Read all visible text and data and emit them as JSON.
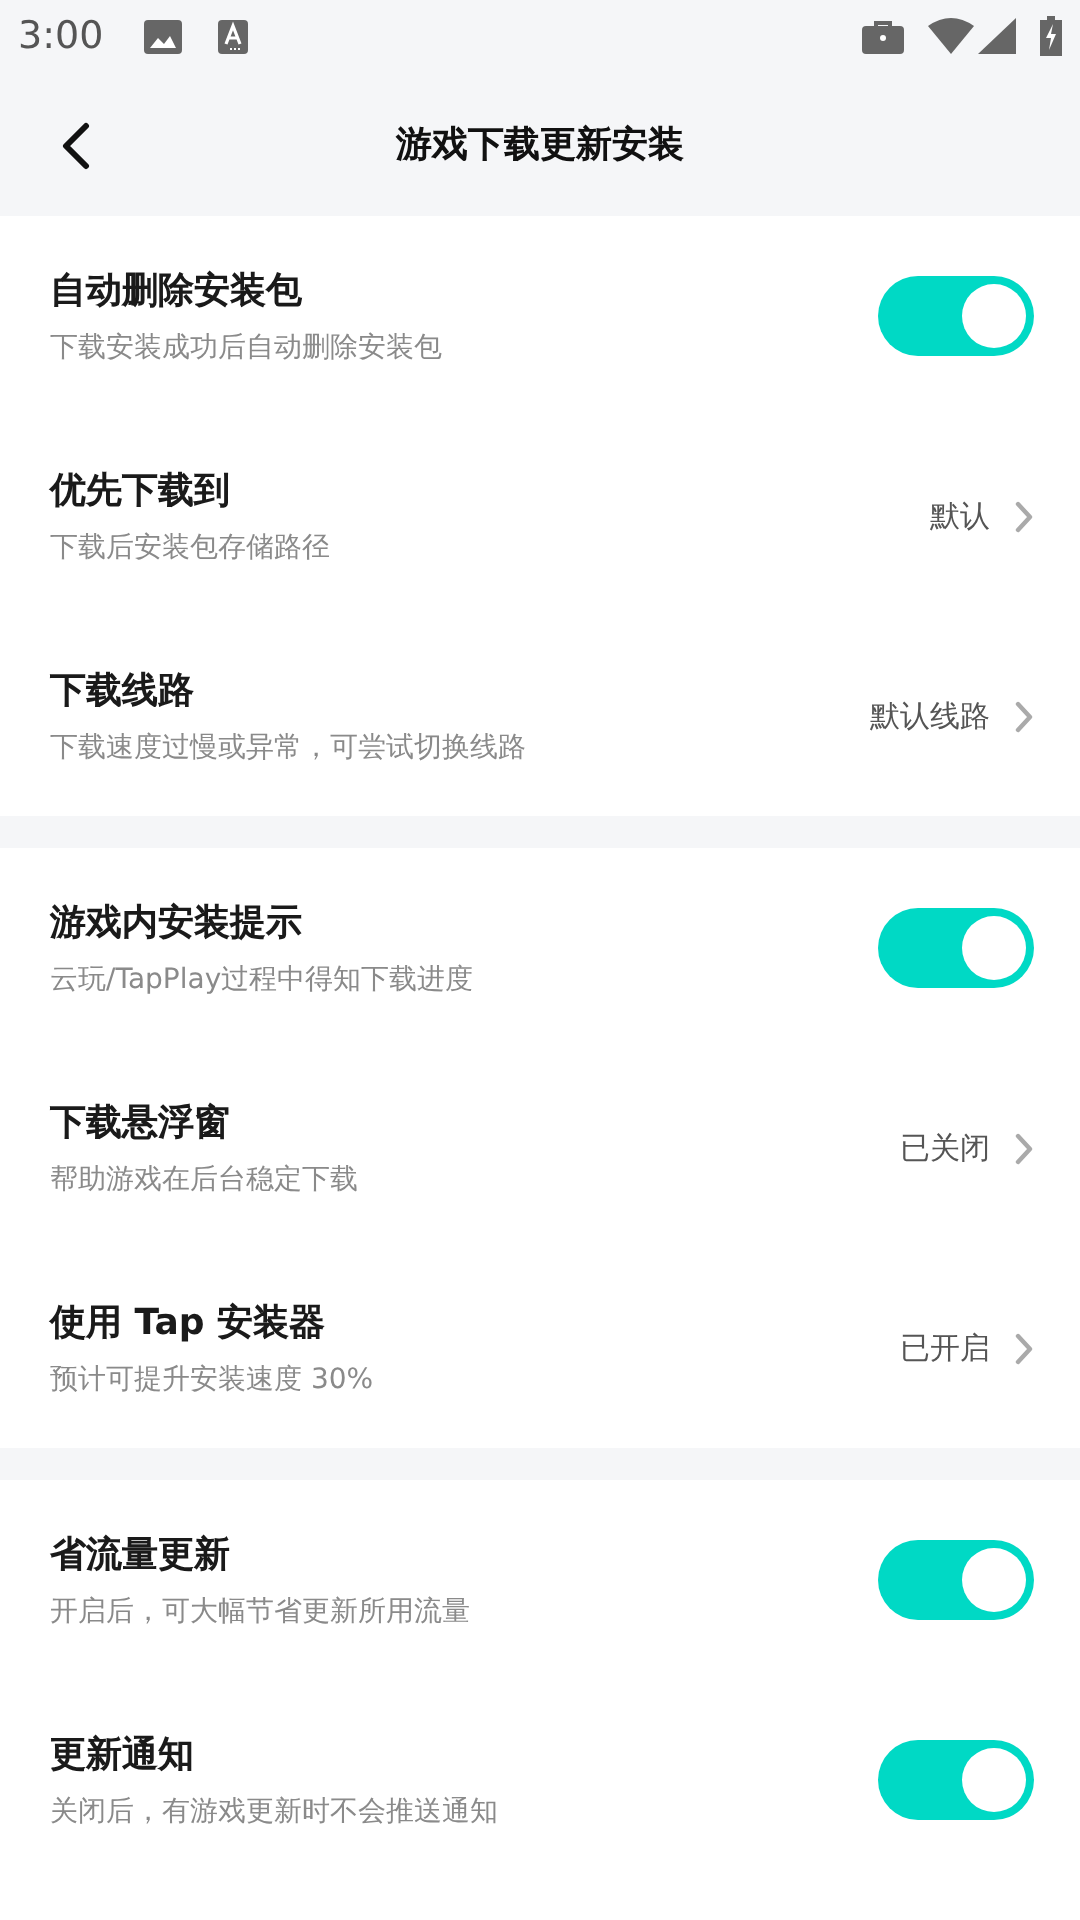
{
  "status_bar": {
    "time": "3:00"
  },
  "header": {
    "title": "游戏下载更新安装"
  },
  "sections": [
    {
      "items": [
        {
          "kind": "toggle",
          "title": "自动删除安装包",
          "subtitle": "下载安装成功后自动删除安装包",
          "on": true
        },
        {
          "kind": "link",
          "title": "优先下载到",
          "subtitle": "下载后安装包存储路径",
          "value": "默认"
        },
        {
          "kind": "link",
          "title": "下载线路",
          "subtitle": "下载速度过慢或异常，可尝试切换线路",
          "value": "默认线路"
        }
      ]
    },
    {
      "items": [
        {
          "kind": "toggle",
          "title": "游戏内安装提示",
          "subtitle": "云玩/TapPlay过程中得知下载进度",
          "on": true
        },
        {
          "kind": "link",
          "title": "下载悬浮窗",
          "subtitle": "帮助游戏在后台稳定下载",
          "value": "已关闭"
        },
        {
          "kind": "link",
          "title": "使用 Tap 安装器",
          "subtitle": "预计可提升安装速度 30%",
          "value": "已开启"
        }
      ]
    },
    {
      "items": [
        {
          "kind": "toggle",
          "title": "省流量更新",
          "subtitle": "开启后，可大幅节省更新所用流量",
          "on": true
        },
        {
          "kind": "toggle",
          "title": "更新通知",
          "subtitle": "关闭后，有游戏更新时不会推送通知",
          "on": true
        }
      ]
    }
  ]
}
